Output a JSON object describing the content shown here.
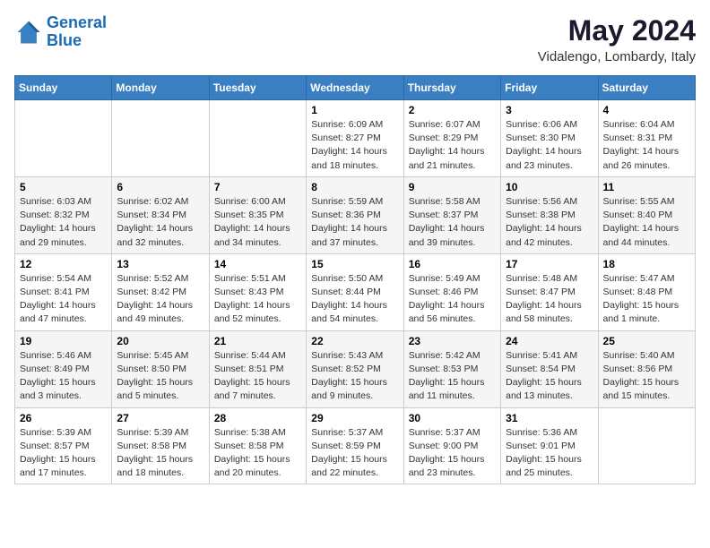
{
  "logo": {
    "line1": "General",
    "line2": "Blue"
  },
  "title": "May 2024",
  "location": "Vidalengo, Lombardy, Italy",
  "weekdays": [
    "Sunday",
    "Monday",
    "Tuesday",
    "Wednesday",
    "Thursday",
    "Friday",
    "Saturday"
  ],
  "weeks": [
    [
      {
        "day": "",
        "info": ""
      },
      {
        "day": "",
        "info": ""
      },
      {
        "day": "",
        "info": ""
      },
      {
        "day": "1",
        "info": "Sunrise: 6:09 AM\nSunset: 8:27 PM\nDaylight: 14 hours\nand 18 minutes."
      },
      {
        "day": "2",
        "info": "Sunrise: 6:07 AM\nSunset: 8:29 PM\nDaylight: 14 hours\nand 21 minutes."
      },
      {
        "day": "3",
        "info": "Sunrise: 6:06 AM\nSunset: 8:30 PM\nDaylight: 14 hours\nand 23 minutes."
      },
      {
        "day": "4",
        "info": "Sunrise: 6:04 AM\nSunset: 8:31 PM\nDaylight: 14 hours\nand 26 minutes."
      }
    ],
    [
      {
        "day": "5",
        "info": "Sunrise: 6:03 AM\nSunset: 8:32 PM\nDaylight: 14 hours\nand 29 minutes."
      },
      {
        "day": "6",
        "info": "Sunrise: 6:02 AM\nSunset: 8:34 PM\nDaylight: 14 hours\nand 32 minutes."
      },
      {
        "day": "7",
        "info": "Sunrise: 6:00 AM\nSunset: 8:35 PM\nDaylight: 14 hours\nand 34 minutes."
      },
      {
        "day": "8",
        "info": "Sunrise: 5:59 AM\nSunset: 8:36 PM\nDaylight: 14 hours\nand 37 minutes."
      },
      {
        "day": "9",
        "info": "Sunrise: 5:58 AM\nSunset: 8:37 PM\nDaylight: 14 hours\nand 39 minutes."
      },
      {
        "day": "10",
        "info": "Sunrise: 5:56 AM\nSunset: 8:38 PM\nDaylight: 14 hours\nand 42 minutes."
      },
      {
        "day": "11",
        "info": "Sunrise: 5:55 AM\nSunset: 8:40 PM\nDaylight: 14 hours\nand 44 minutes."
      }
    ],
    [
      {
        "day": "12",
        "info": "Sunrise: 5:54 AM\nSunset: 8:41 PM\nDaylight: 14 hours\nand 47 minutes."
      },
      {
        "day": "13",
        "info": "Sunrise: 5:52 AM\nSunset: 8:42 PM\nDaylight: 14 hours\nand 49 minutes."
      },
      {
        "day": "14",
        "info": "Sunrise: 5:51 AM\nSunset: 8:43 PM\nDaylight: 14 hours\nand 52 minutes."
      },
      {
        "day": "15",
        "info": "Sunrise: 5:50 AM\nSunset: 8:44 PM\nDaylight: 14 hours\nand 54 minutes."
      },
      {
        "day": "16",
        "info": "Sunrise: 5:49 AM\nSunset: 8:46 PM\nDaylight: 14 hours\nand 56 minutes."
      },
      {
        "day": "17",
        "info": "Sunrise: 5:48 AM\nSunset: 8:47 PM\nDaylight: 14 hours\nand 58 minutes."
      },
      {
        "day": "18",
        "info": "Sunrise: 5:47 AM\nSunset: 8:48 PM\nDaylight: 15 hours\nand 1 minute."
      }
    ],
    [
      {
        "day": "19",
        "info": "Sunrise: 5:46 AM\nSunset: 8:49 PM\nDaylight: 15 hours\nand 3 minutes."
      },
      {
        "day": "20",
        "info": "Sunrise: 5:45 AM\nSunset: 8:50 PM\nDaylight: 15 hours\nand 5 minutes."
      },
      {
        "day": "21",
        "info": "Sunrise: 5:44 AM\nSunset: 8:51 PM\nDaylight: 15 hours\nand 7 minutes."
      },
      {
        "day": "22",
        "info": "Sunrise: 5:43 AM\nSunset: 8:52 PM\nDaylight: 15 hours\nand 9 minutes."
      },
      {
        "day": "23",
        "info": "Sunrise: 5:42 AM\nSunset: 8:53 PM\nDaylight: 15 hours\nand 11 minutes."
      },
      {
        "day": "24",
        "info": "Sunrise: 5:41 AM\nSunset: 8:54 PM\nDaylight: 15 hours\nand 13 minutes."
      },
      {
        "day": "25",
        "info": "Sunrise: 5:40 AM\nSunset: 8:56 PM\nDaylight: 15 hours\nand 15 minutes."
      }
    ],
    [
      {
        "day": "26",
        "info": "Sunrise: 5:39 AM\nSunset: 8:57 PM\nDaylight: 15 hours\nand 17 minutes."
      },
      {
        "day": "27",
        "info": "Sunrise: 5:39 AM\nSunset: 8:58 PM\nDaylight: 15 hours\nand 18 minutes."
      },
      {
        "day": "28",
        "info": "Sunrise: 5:38 AM\nSunset: 8:58 PM\nDaylight: 15 hours\nand 20 minutes."
      },
      {
        "day": "29",
        "info": "Sunrise: 5:37 AM\nSunset: 8:59 PM\nDaylight: 15 hours\nand 22 minutes."
      },
      {
        "day": "30",
        "info": "Sunrise: 5:37 AM\nSunset: 9:00 PM\nDaylight: 15 hours\nand 23 minutes."
      },
      {
        "day": "31",
        "info": "Sunrise: 5:36 AM\nSunset: 9:01 PM\nDaylight: 15 hours\nand 25 minutes."
      },
      {
        "day": "",
        "info": ""
      }
    ]
  ]
}
